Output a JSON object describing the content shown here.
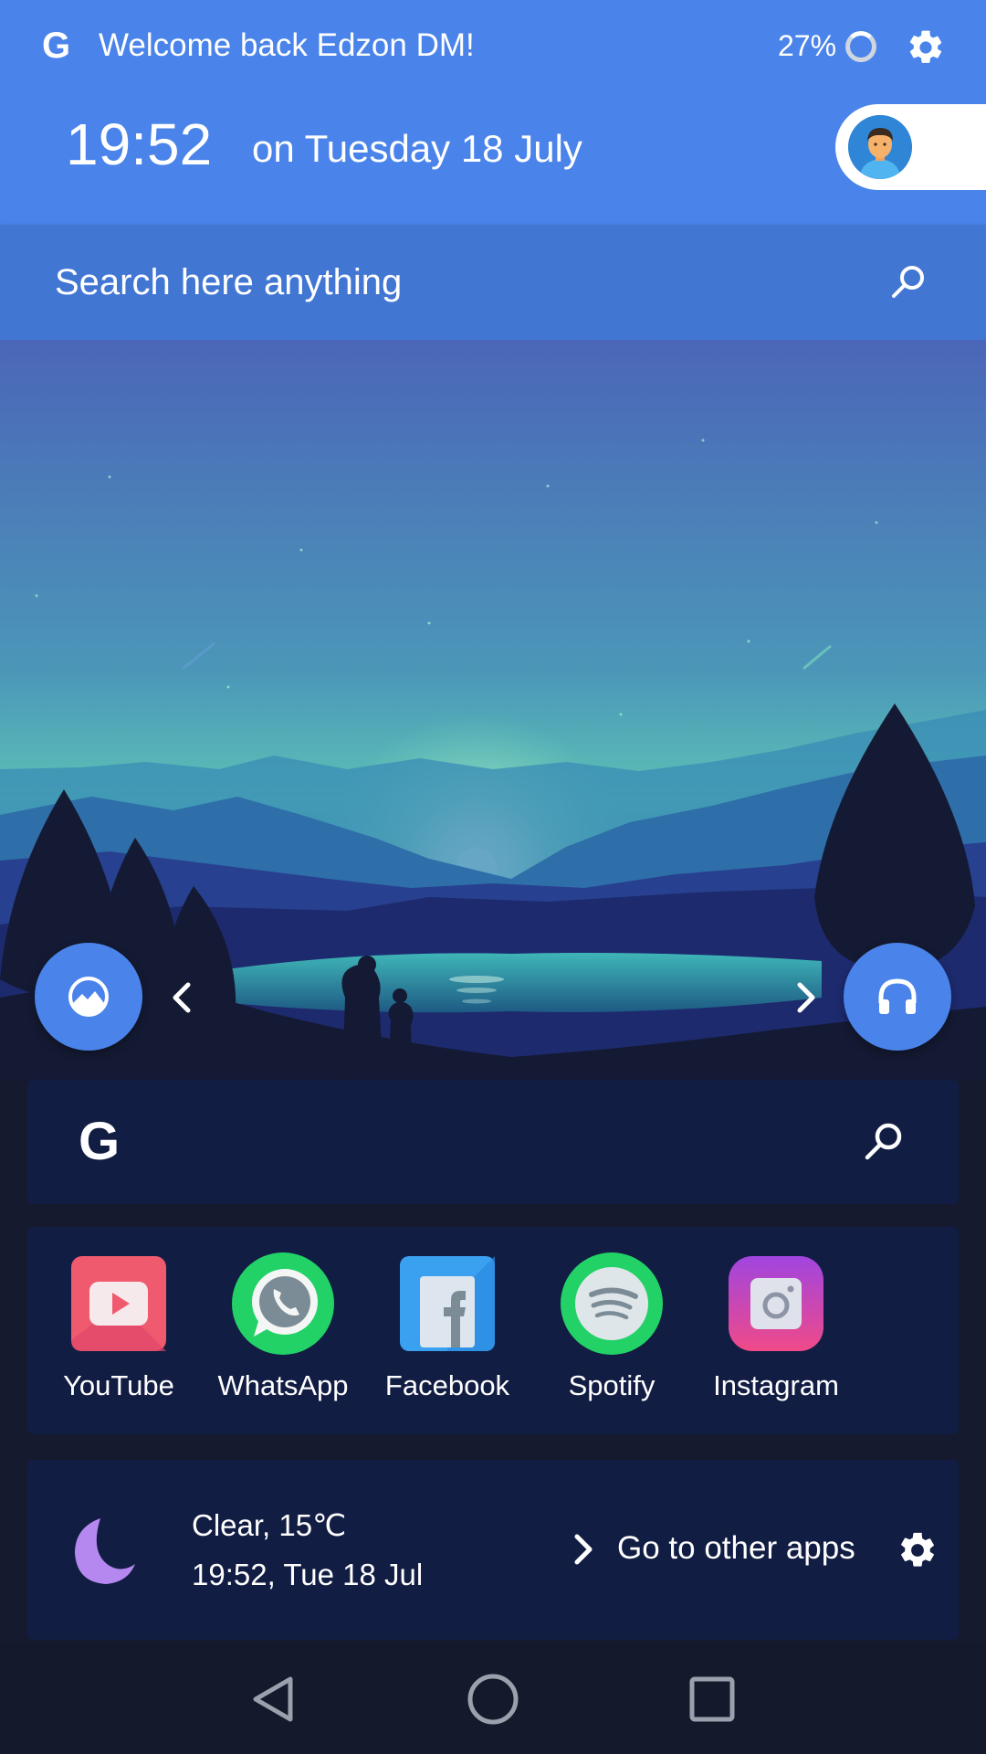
{
  "header": {
    "welcome": "Welcome back Edzon DM!",
    "battery": "27%",
    "time": "19:52",
    "date": "on Tuesday 18 July"
  },
  "search": {
    "placeholder": "Search here anything"
  },
  "apps": [
    {
      "label": "YouTube",
      "icon": "youtube-icon"
    },
    {
      "label": "WhatsApp",
      "icon": "whatsapp-icon"
    },
    {
      "label": "Facebook",
      "icon": "facebook-icon"
    },
    {
      "label": "Spotify",
      "icon": "spotify-icon"
    },
    {
      "label": "Instagram",
      "icon": "instagram-icon"
    }
  ],
  "weather": {
    "condition": "Clear, 15℃",
    "datetime": "19:52, Tue 18 Jul",
    "other_apps": "Go to other apps"
  },
  "colors": {
    "header_bg": "#4a84ea",
    "search_bg": "#4276d3",
    "card_bg": "#121d43",
    "page_bg": "#151a2e"
  }
}
